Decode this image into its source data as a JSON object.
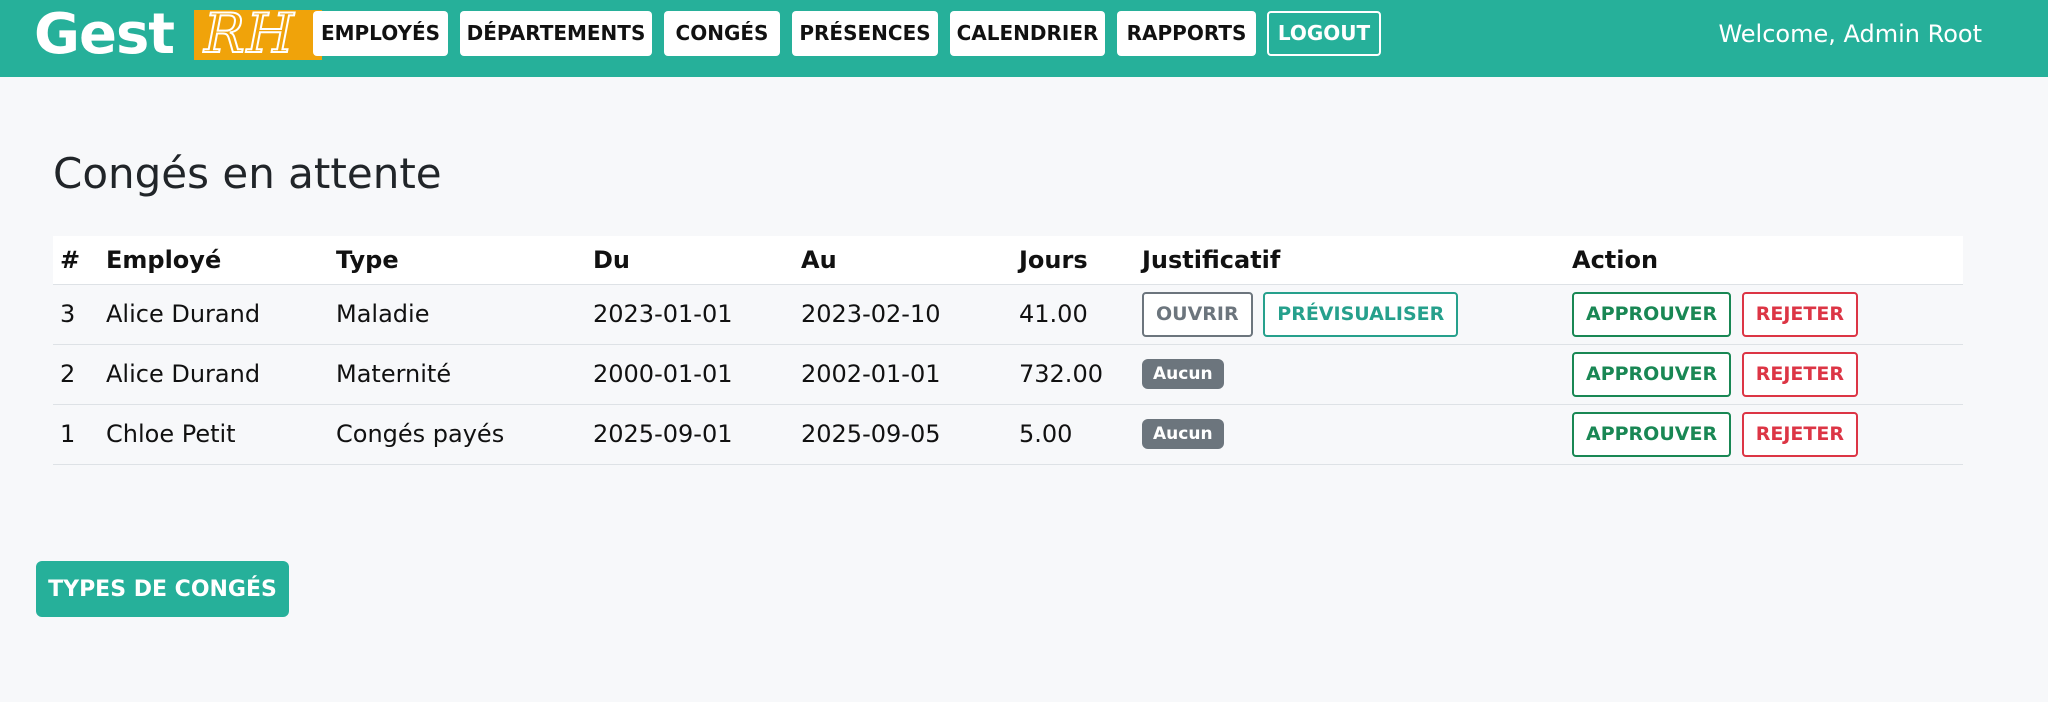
{
  "brand": {
    "part1": "Gest",
    "part2": "RH",
    "colors": {
      "bar": "#26b09a",
      "logo_box": "#f0a30a"
    }
  },
  "nav": {
    "items": [
      {
        "label": "EMPLOYÉS"
      },
      {
        "label": "DÉPARTEMENTS"
      },
      {
        "label": "CONGÉS"
      },
      {
        "label": "PRÉSENCES"
      },
      {
        "label": "CALENDRIER"
      },
      {
        "label": "RAPPORTS"
      }
    ],
    "logout": "LOGOUT",
    "welcome": "Welcome, Admin Root"
  },
  "page": {
    "title": "Congés en attente"
  },
  "table": {
    "headers": [
      "#",
      "Employé",
      "Type",
      "Du",
      "Au",
      "Jours",
      "Justificatif",
      "Action"
    ],
    "rows": [
      {
        "id": "3",
        "employee": "Alice Durand",
        "type": "Maladie",
        "from": "2023-01-01",
        "to": "2023-02-10",
        "days": "41.00",
        "justificatif": {
          "open": "OUVRIR",
          "preview": "PRÉVISUALISER"
        },
        "approve": "APPROUVER",
        "reject": "REJETER"
      },
      {
        "id": "2",
        "employee": "Alice Durand",
        "type": "Maternité",
        "from": "2000-01-01",
        "to": "2002-01-01",
        "days": "732.00",
        "justificatif": {
          "badge": "Aucun"
        },
        "approve": "APPROUVER",
        "reject": "REJETER"
      },
      {
        "id": "1",
        "employee": "Chloe Petit",
        "type": "Congés payés",
        "from": "2025-09-01",
        "to": "2025-09-05",
        "days": "5.00",
        "justificatif": {
          "badge": "Aucun"
        },
        "approve": "APPROUVER",
        "reject": "REJETER"
      }
    ]
  },
  "footer": {
    "types_button": "TYPES DE CONGÉS"
  }
}
